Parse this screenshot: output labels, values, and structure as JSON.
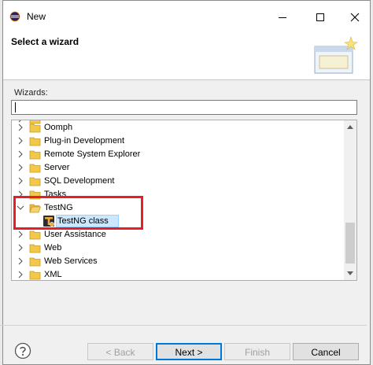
{
  "window": {
    "title": "New"
  },
  "banner": {
    "title": "Select a wizard"
  },
  "wizards_label": "Wizards:",
  "filter": {
    "value": "",
    "placeholder": ""
  },
  "tree": {
    "items": [
      {
        "label": "Oomph",
        "expanded": false,
        "icon": "folder-icon"
      },
      {
        "label": "Plug-in Development",
        "expanded": false,
        "icon": "folder-icon"
      },
      {
        "label": "Remote System Explorer",
        "expanded": false,
        "icon": "folder-icon"
      },
      {
        "label": "Server",
        "expanded": false,
        "icon": "folder-icon"
      },
      {
        "label": "SQL Development",
        "expanded": false,
        "icon": "folder-icon"
      },
      {
        "label": "Tasks",
        "expanded": false,
        "icon": "folder-icon"
      },
      {
        "label": "TestNG",
        "expanded": true,
        "icon": "folder-icon",
        "children": [
          {
            "label": "TestNG class",
            "icon": "testng-icon",
            "selected": true
          }
        ]
      },
      {
        "label": "User Assistance",
        "expanded": false,
        "icon": "folder-icon"
      },
      {
        "label": "Web",
        "expanded": false,
        "icon": "folder-icon"
      },
      {
        "label": "Web Services",
        "expanded": false,
        "icon": "folder-icon"
      },
      {
        "label": "XML",
        "expanded": false,
        "icon": "folder-icon"
      }
    ]
  },
  "buttons": {
    "back": "< Back",
    "next": "Next >",
    "finish": "Finish",
    "cancel": "Cancel"
  },
  "colors": {
    "highlight": "#e41f26",
    "selection": "#cce8ff",
    "default_button": "#0078d7"
  }
}
